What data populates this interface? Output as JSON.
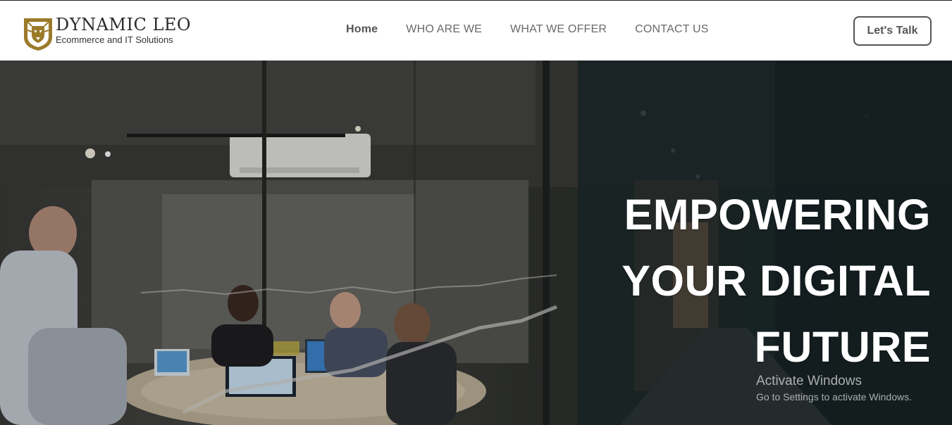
{
  "brand": {
    "name": "DYNAMIC LEO",
    "tagline": "Ecommerce and IT Solutions",
    "logo_icon": "lion-head-shield-icon",
    "logo_color": "#9b7a2a"
  },
  "nav": {
    "items": [
      {
        "label": "Home",
        "active": true
      },
      {
        "label": "WHO ARE WE",
        "active": false
      },
      {
        "label": "WHAT WE OFFER",
        "active": false
      },
      {
        "label": "CONTACT US",
        "active": false
      }
    ],
    "cta_label": "Let's Talk"
  },
  "hero": {
    "lines": [
      "EMPOWERING",
      "YOUR DIGITAL",
      "FUTURE"
    ],
    "image": "office meeting room photo"
  },
  "watermark": {
    "title": "Activate Windows",
    "subtitle": "Go to Settings to activate Windows."
  }
}
